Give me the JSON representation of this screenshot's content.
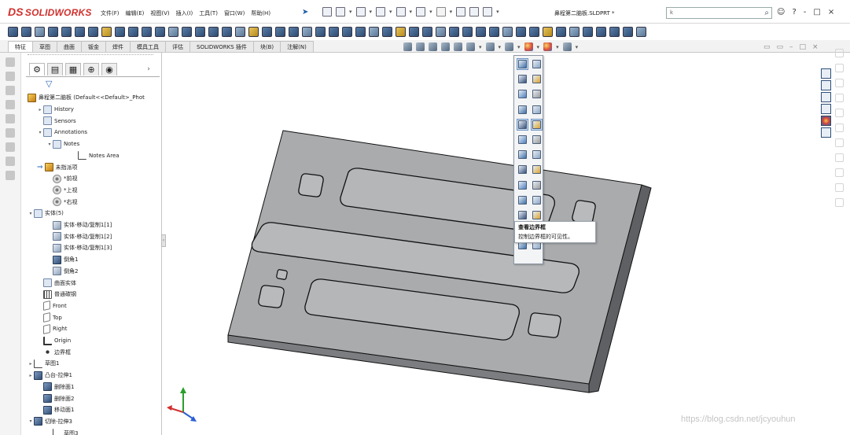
{
  "app": {
    "logo": "SOLIDWORKS",
    "logo_prefix": "DS",
    "menu": [
      "文件(F)",
      "编辑(E)",
      "视图(V)",
      "插入(I)",
      "工具(T)",
      "窗口(W)",
      "帮助(H)"
    ],
    "document_title": "鼻程第二脑板.SLDPRT *",
    "search_placeholder": "k",
    "window_controls": [
      "?",
      "-",
      "□",
      "×"
    ]
  },
  "command_tabs": [
    "特征",
    "草图",
    "曲面",
    "钣金",
    "焊件",
    "模具工具",
    "评估",
    "SOLIDWORKS 插件",
    "块(B)",
    "注解(N)"
  ],
  "feature_tree": {
    "root": "鼻程第二脑板  (Default<<Default>_Phot",
    "items": [
      {
        "label": "History",
        "icon": "history-icon"
      },
      {
        "label": "Sensors",
        "icon": "sensors-icon"
      },
      {
        "label": "Annotations",
        "icon": "annotations-icon"
      },
      {
        "label": "Notes",
        "icon": "notes-icon"
      },
      {
        "label": "Notes Area",
        "icon": "notes-area-icon"
      },
      {
        "label": "未指派项",
        "icon": "unassigned-icon"
      },
      {
        "label": "*前视",
        "icon": "view-icon"
      },
      {
        "label": "*上视",
        "icon": "view-icon"
      },
      {
        "label": "*右视",
        "icon": "view-icon"
      },
      {
        "label": "实体(5)",
        "icon": "solid-bodies-icon"
      },
      {
        "label": "实体-移动/复制1[1]",
        "icon": "body-icon"
      },
      {
        "label": "实体-移动/复制1[2]",
        "icon": "body-icon"
      },
      {
        "label": "实体-移动/复制1[3]",
        "icon": "body-icon"
      },
      {
        "label": "倒角1",
        "icon": "chamfer-icon"
      },
      {
        "label": "倒角2",
        "icon": "body-icon"
      },
      {
        "label": "曲面实体",
        "icon": "surface-bodies-icon"
      },
      {
        "label": "普通碳钢",
        "icon": "material-icon"
      },
      {
        "label": "Front",
        "icon": "plane-icon"
      },
      {
        "label": "Top",
        "icon": "plane-icon"
      },
      {
        "label": "Right",
        "icon": "plane-icon"
      },
      {
        "label": "Origin",
        "icon": "origin-icon"
      },
      {
        "label": "边界框",
        "icon": "bounding-box-icon"
      },
      {
        "label": "草图1",
        "icon": "sketch-icon"
      },
      {
        "label": "凸台-拉伸1",
        "icon": "extrude-icon"
      },
      {
        "label": "删除面1",
        "icon": "delete-face-icon"
      },
      {
        "label": "删除面2",
        "icon": "delete-face-icon"
      },
      {
        "label": "移动面1",
        "icon": "move-face-icon"
      },
      {
        "label": "切除-拉伸3",
        "icon": "cut-extrude-icon"
      },
      {
        "label": "草图3",
        "icon": "sketch-icon"
      }
    ]
  },
  "tooltip": {
    "title": "查看边界框",
    "description": "控制边界框的可见性。"
  },
  "watermark": "https://blog.csdn.net/jcyouhun",
  "colors": {
    "accent": "#2d6ab4",
    "logo_red": "#d0312d",
    "part_face": "#a9abad",
    "part_side": "#6b6d70",
    "part_edge": "#1a1a1a"
  }
}
